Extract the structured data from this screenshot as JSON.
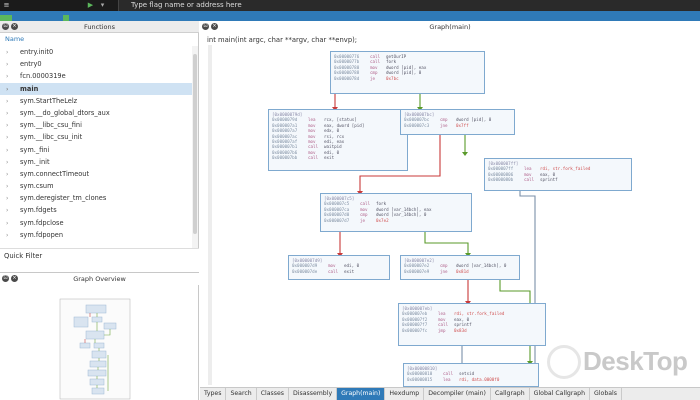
{
  "toolbar": {
    "address_placeholder": "Type flag name or address here"
  },
  "functions_panel": {
    "title": "Functions",
    "column_header": "Name",
    "items": [
      {
        "label": "entry.init0"
      },
      {
        "label": "entry0"
      },
      {
        "label": "fcn.0000319e"
      },
      {
        "label": "main",
        "selected": true
      },
      {
        "label": "sym.StartTheLelz"
      },
      {
        "label": "sym.__do_global_dtors_aux"
      },
      {
        "label": "sym.__libc_csu_fini"
      },
      {
        "label": "sym.__libc_csu_init"
      },
      {
        "label": "sym._fini"
      },
      {
        "label": "sym._init"
      },
      {
        "label": "sym.connectTimeout"
      },
      {
        "label": "sym.csum"
      },
      {
        "label": "sym.deregister_tm_clones"
      },
      {
        "label": "sym.fdgets"
      },
      {
        "label": "sym.fdpclose"
      },
      {
        "label": "sym.fdpopen"
      }
    ],
    "quick_filter": "Quick Filter"
  },
  "overview_panel": {
    "title": "Graph Overview"
  },
  "graph_panel": {
    "title": "Graph(main)",
    "signature": "int main(int argc, char **argv, char **envp);"
  },
  "blocks": {
    "b1": {
      "lines": [
        {
          "addr": "0x00000776",
          "mnem": "call",
          "ops": "getOurIP"
        },
        {
          "addr": "0x0000077b",
          "mnem": "call",
          "ops": "fork"
        },
        {
          "addr": "0x00000780",
          "mnem": "mov",
          "ops": "dword [pid], eax"
        },
        {
          "addr": "0x00000788",
          "mnem": "cmp",
          "ops": "dword [pid], 0"
        },
        {
          "addr": "0x0000078d",
          "mnem": "je",
          "ops": "0x7bc",
          "red": true
        }
      ]
    },
    "b2": {
      "header": "[0x0000079d]",
      "lines": [
        {
          "addr": "0x0000079d",
          "mnem": "lea",
          "ops": "rcx, [status]"
        },
        {
          "addr": "0x000007a1",
          "mnem": "mov",
          "ops": "eax, dword [pid]"
        },
        {
          "addr": "0x000007a7",
          "mnem": "mov",
          "ops": "edx, 0"
        },
        {
          "addr": "0x000007ac",
          "mnem": "mov",
          "ops": "rsi, rcx"
        },
        {
          "addr": "0x000007af",
          "mnem": "mov",
          "ops": "edi, eax"
        },
        {
          "addr": "0x000007b1",
          "mnem": "call",
          "ops": "waitpid"
        },
        {
          "addr": "0x000007b6",
          "mnem": "mov",
          "ops": "edi, 0"
        },
        {
          "addr": "0x000007bb",
          "mnem": "call",
          "ops": "exit"
        }
      ]
    },
    "b3": {
      "header": "[0x000007bc]",
      "lines": [
        {
          "addr": "0x000007bc",
          "mnem": "cmp",
          "ops": "dword [pid], 0"
        },
        {
          "addr": "0x000007c3",
          "mnem": "jne",
          "ops": "0x7ff",
          "red": true
        }
      ]
    },
    "b4": {
      "header": "[0x000007ff]",
      "lines": [
        {
          "addr": "0x000007ff",
          "mnem": "lea",
          "ops": "rdi, str.fork_failed",
          "red": true
        },
        {
          "addr": "0x00000806",
          "mnem": "mov",
          "ops": "eax, 0"
        },
        {
          "addr": "0x0000080b",
          "mnem": "call",
          "ops": "sprintf"
        }
      ]
    },
    "b5": {
      "header": "[0x000007c5]",
      "lines": [
        {
          "addr": "0x000007c5",
          "mnem": "call",
          "ops": "fork"
        },
        {
          "addr": "0x000007ca",
          "mnem": "mov",
          "ops": "dword [var_14bch], eax"
        },
        {
          "addr": "0x000007d0",
          "mnem": "cmp",
          "ops": "dword [var_14bch], 0"
        },
        {
          "addr": "0x000007d7",
          "mnem": "je",
          "ops": "0x7e2",
          "red": true
        }
      ]
    },
    "b6": {
      "header": "[0x000007d9]",
      "lines": [
        {
          "addr": "0x000007d9",
          "mnem": "mov",
          "ops": "edi, 0"
        },
        {
          "addr": "0x000007de",
          "mnem": "call",
          "ops": "exit"
        }
      ]
    },
    "b7": {
      "header": "[0x000007e2]",
      "lines": [
        {
          "addr": "0x000007e2",
          "mnem": "cmp",
          "ops": "dword [var_14bch], 0"
        },
        {
          "addr": "0x000007e9",
          "mnem": "jne",
          "ops": "0x81d",
          "red": true
        }
      ]
    },
    "b8": {
      "header": "[0x000007eb]",
      "lines": [
        {
          "addr": "0x000007eb",
          "mnem": "lea",
          "ops": "rdi, str.fork_failed",
          "red": true
        },
        {
          "addr": "0x000007f2",
          "mnem": "mov",
          "ops": "eax, 0"
        },
        {
          "addr": "0x000007f7",
          "mnem": "call",
          "ops": "sprintf"
        },
        {
          "addr": "0x000007fc",
          "mnem": "jmp",
          "ops": "0x83d",
          "red": true
        }
      ]
    },
    "b9": {
      "header": "[0x00000810]",
      "lines": [
        {
          "addr": "0x00000810",
          "mnem": "call",
          "ops": "setsid"
        },
        {
          "addr": "0x00000815",
          "mnem": "lea",
          "ops": "rdi, data.0000f0",
          "red": true
        }
      ]
    }
  },
  "tabs": [
    {
      "label": "Types"
    },
    {
      "label": "Search"
    },
    {
      "label": "Classes"
    },
    {
      "label": "Disassembly"
    },
    {
      "label": "Graph(main)",
      "active": true
    },
    {
      "label": "Hexdump"
    },
    {
      "label": "Decompiler (main)"
    },
    {
      "label": "Callgraph"
    },
    {
      "label": "Global Callgraph"
    },
    {
      "label": "Globals"
    }
  ],
  "watermark": {
    "text": "DeskTop"
  },
  "colors": {
    "accent": "#2f7ab8",
    "edge_true": "#5a9a2a",
    "edge_false": "#c83a3a",
    "edge_uncond": "#7a8fa8"
  }
}
